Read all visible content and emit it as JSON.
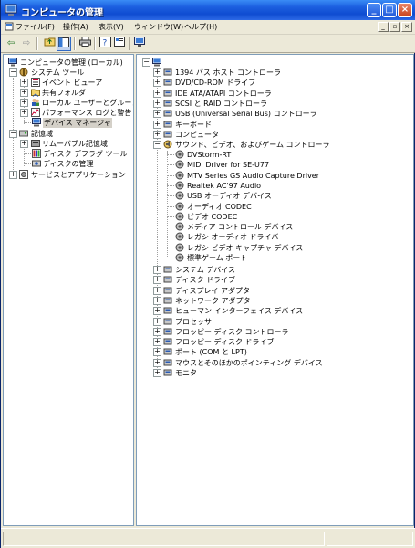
{
  "window": {
    "title": "コンピュータの管理"
  },
  "window_buttons": {
    "minimize": "_",
    "maximize": "□",
    "close": "×"
  },
  "menubar": {
    "items": [
      "ファイル(F)",
      "操作(A)",
      "表示(V)",
      "ウィンドウ(W)",
      "ヘルプ(H)"
    ]
  },
  "mdi_buttons": {
    "minimize": "_",
    "restore": "▫",
    "close": "×"
  },
  "left_tree": {
    "root": "コンピュータの管理 (ローカル)",
    "items": [
      "システム ツール",
      "イベント ビューア",
      "共有フォルダ",
      "ローカル ユーザーとグループ",
      "パフォーマンス ログと警告",
      "デバイス マネージャ",
      "記憶域",
      "リムーバブル記憶域",
      "ディスク デフラグ ツール",
      "ディスクの管理",
      "サービスとアプリケーション"
    ],
    "selected": "デバイス マネージャ"
  },
  "right_tree": {
    "root": "",
    "categories_top": [
      "1394 バス ホスト コントローラ",
      "DVD/CD-ROM ドライブ",
      "IDE ATA/ATAPI コントローラ",
      "SCSI と RAID コントローラ",
      "USB (Universal Serial Bus) コントローラ",
      "キーボード",
      "コンピュータ"
    ],
    "expanded_category": "サウンド、ビデオ、およびゲーム コントローラ",
    "expanded_children": [
      "DVStorm-RT",
      "MIDI Driver for SE-U77",
      "MTV Series GS Audio Capture Driver",
      "Realtek AC'97 Audio",
      "USB オーディオ デバイス",
      "オーディオ CODEC",
      "ビデオ CODEC",
      "メディア コントロール デバイス",
      "レガシ オーディオ ドライバ",
      "レガシ ビデオ キャプチャ デバイス",
      "標準ゲーム ポート"
    ],
    "categories_bottom": [
      "システム デバイス",
      "ディスク ドライブ",
      "ディスプレイ アダプタ",
      "ネットワーク アダプタ",
      "ヒューマン インターフェイス デバイス",
      "プロセッサ",
      "フロッピー ディスク コントローラ",
      "フロッピー ディスク ドライブ",
      "ポート (COM と LPT)",
      "マウスとそのほかのポインティング デバイス",
      "モニタ"
    ]
  },
  "colors": {
    "title_bar": "#0f4cd1",
    "face": "#ece9d8",
    "pane_border": "#7f9db9"
  }
}
